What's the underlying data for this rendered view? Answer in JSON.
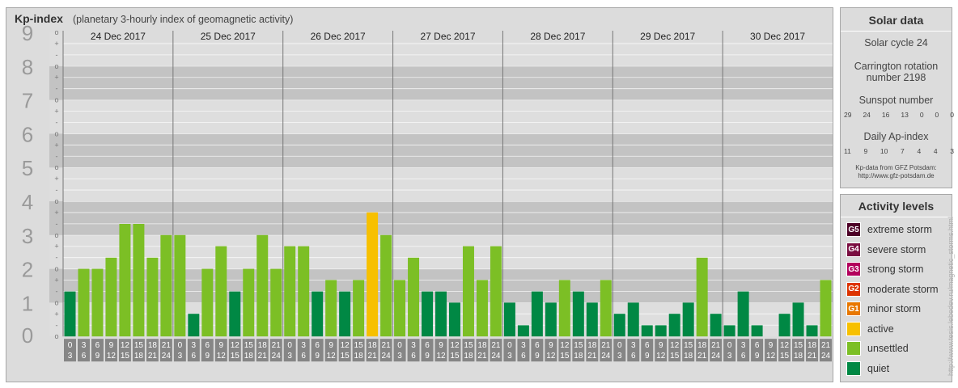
{
  "header": {
    "title": "Kp-index",
    "subtitle": "(planetary 3-hourly index of geomagnetic activity)"
  },
  "chart_data": {
    "type": "bar",
    "title": "Kp-index",
    "subtitle": "(planetary 3-hourly index of geomagnetic activity)",
    "ylim": [
      0,
      9
    ],
    "y_ticks": [
      "0",
      "1",
      "2",
      "3",
      "4",
      "5",
      "6",
      "7",
      "8",
      "9"
    ],
    "y_minor_ticks": [
      "o",
      "+",
      "-",
      "o",
      "+",
      "-",
      "o",
      "+",
      "-",
      "o",
      "+",
      "-",
      "o",
      "+",
      "-",
      "o",
      "+",
      "-",
      "o",
      "+",
      "-",
      "o",
      "+",
      "-",
      "o",
      "+",
      "-",
      "o"
    ],
    "days": [
      "24 Dec 2017",
      "25 Dec 2017",
      "26 Dec 2017",
      "27 Dec 2017",
      "28 Dec 2017",
      "29 Dec 2017",
      "30 Dec 2017"
    ],
    "interval_labels": [
      [
        "0",
        "3"
      ],
      [
        "3",
        "6"
      ],
      [
        "6",
        "9"
      ],
      [
        "9",
        "12"
      ],
      [
        "12",
        "15"
      ],
      [
        "15",
        "18"
      ],
      [
        "18",
        "21"
      ],
      [
        "21",
        "24"
      ]
    ],
    "values": [
      1.33,
      2.0,
      2.0,
      2.33,
      3.33,
      3.33,
      2.33,
      3.0,
      3.0,
      0.67,
      2.0,
      2.67,
      1.33,
      2.0,
      3.0,
      2.0,
      2.67,
      2.67,
      1.33,
      1.67,
      1.33,
      1.67,
      3.67,
      3.0,
      1.67,
      2.33,
      1.33,
      1.33,
      1.0,
      2.67,
      1.67,
      2.67,
      1.0,
      0.33,
      1.33,
      1.0,
      1.67,
      1.33,
      1.0,
      1.67,
      0.67,
      1.0,
      0.33,
      0.33,
      0.67,
      1.0,
      2.33,
      0.67,
      0.33,
      1.33,
      0.33,
      0.0,
      0.67,
      1.0,
      0.33,
      1.67
    ],
    "grid": true
  },
  "solar": {
    "title": "Solar data",
    "cycle": "Solar cycle 24",
    "carrington_line1": "Carrington rotation",
    "carrington_line2": "number 2198",
    "sunspot_title": "Sunspot number",
    "sunspot_values": [
      "29",
      "24",
      "16",
      "13",
      "0",
      "0",
      "0"
    ],
    "ap_title": "Daily Ap-index",
    "ap_values": [
      "11",
      "9",
      "10",
      "7",
      "4",
      "4",
      "3"
    ],
    "source_line1": "Kp-data from GFZ Potsdam:",
    "source_line2": "http://www.gfz-potsdam.de"
  },
  "legend": {
    "title": "Activity levels",
    "items": [
      {
        "badge": "G5",
        "label": "extreme storm",
        "color": "#4d0026"
      },
      {
        "badge": "G4",
        "label": "severe storm",
        "color": "#7a0d40"
      },
      {
        "badge": "G3",
        "label": "strong storm",
        "color": "#b3005c"
      },
      {
        "badge": "G2",
        "label": "moderate storm",
        "color": "#dd3300"
      },
      {
        "badge": "G1",
        "label": "minor storm",
        "color": "#e87700"
      },
      {
        "badge": "",
        "label": "active",
        "color": "#f7c000"
      },
      {
        "badge": "",
        "label": "unsettled",
        "color": "#7cbf25"
      },
      {
        "badge": "",
        "label": "quiet",
        "color": "#008844"
      }
    ]
  },
  "colors": {
    "quiet": "#008844",
    "unsettled": "#7cbf25",
    "active": "#f7c000",
    "band_dark": "#c3c3c3",
    "band_light": "#dedede",
    "axis_bg": "#868686"
  },
  "watermark": "http://www.tesis.lebedev.ru/magnetic_storms.html"
}
